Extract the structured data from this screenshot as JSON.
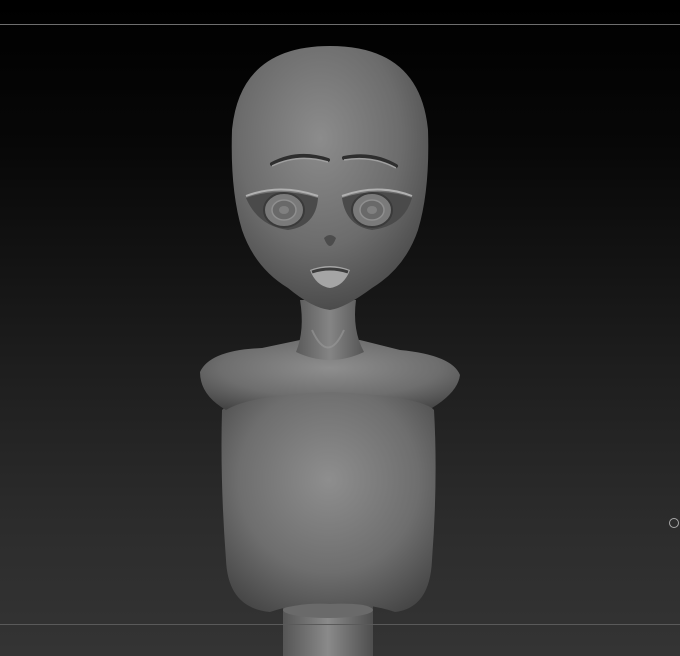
{
  "viewport": {
    "background_top": "#000000",
    "background_bottom": "#343434"
  },
  "model": {
    "material_light": "#9a9a9a",
    "material_dark": "#2e2e2e"
  },
  "icons": {
    "gizmo": "circle-outline-icon"
  }
}
